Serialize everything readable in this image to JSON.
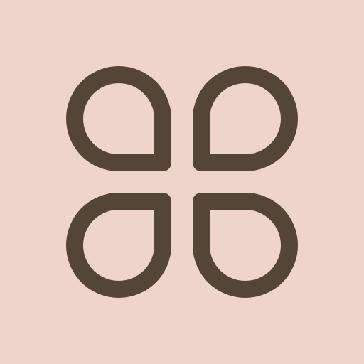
{
  "icon": {
    "name": "four-petal-clover-icon",
    "petals": [
      "top-left",
      "top-right",
      "bottom-left",
      "bottom-right"
    ]
  },
  "colors": {
    "background": "#efd4cc",
    "stroke": "#544535"
  }
}
